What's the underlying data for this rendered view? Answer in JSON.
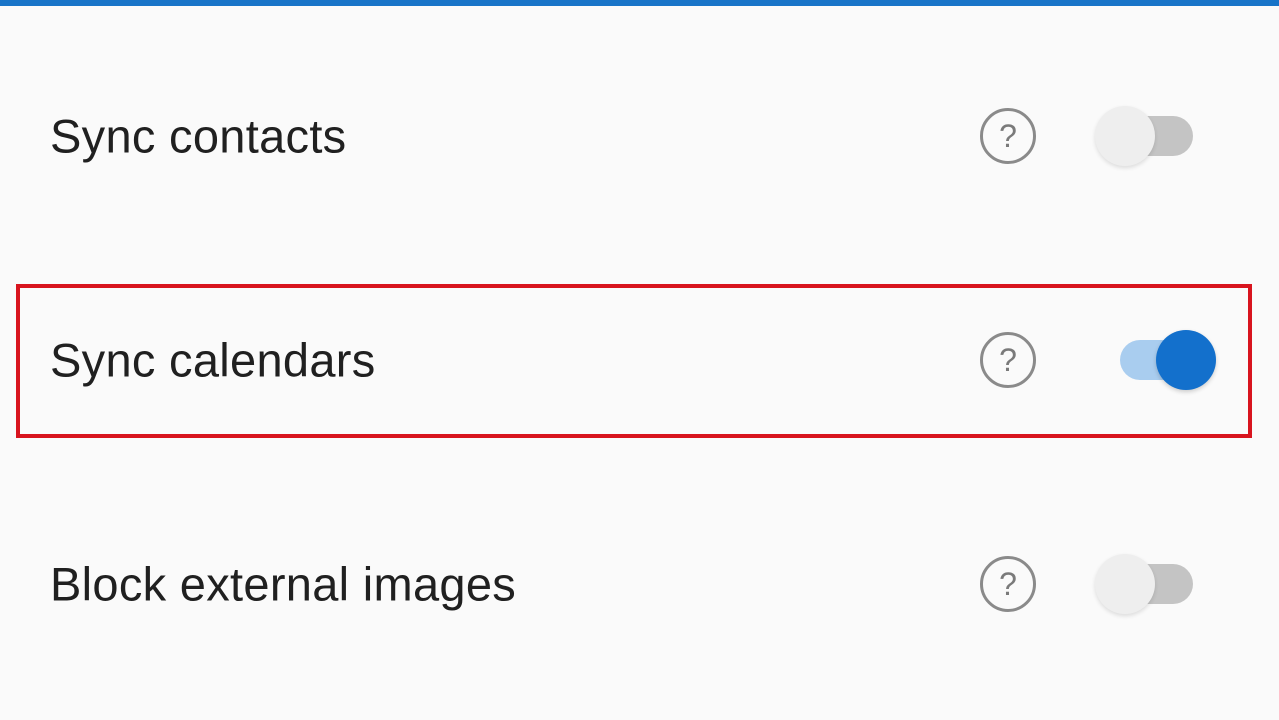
{
  "colors": {
    "accent": "#1874c8",
    "toggle_on": "#1370cc",
    "toggle_on_track": "#a9cdef",
    "toggle_off_track": "#c4c4c4",
    "highlight": "#d8141e"
  },
  "settings": [
    {
      "label": "Sync contacts",
      "help_glyph": "?",
      "help_icon": "question-circle-icon",
      "enabled": false
    },
    {
      "label": "Sync calendars",
      "help_glyph": "?",
      "help_icon": "question-circle-icon",
      "enabled": true
    },
    {
      "label": "Block external images",
      "help_glyph": "?",
      "help_icon": "question-circle-icon",
      "enabled": false
    }
  ]
}
